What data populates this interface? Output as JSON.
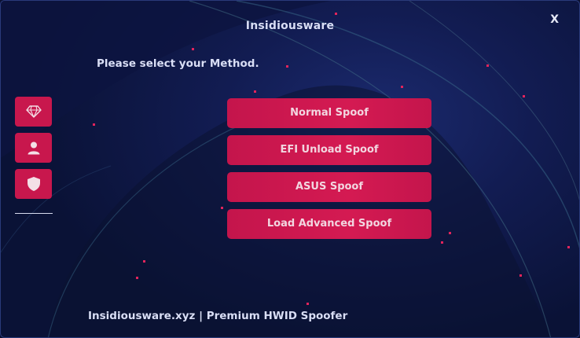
{
  "window": {
    "title": "Insidiousware",
    "close_label": "X"
  },
  "prompt": "Please select your Method.",
  "sidebar": {
    "items": [
      {
        "name": "diamond-icon"
      },
      {
        "name": "user-icon"
      },
      {
        "name": "shield-icon"
      }
    ]
  },
  "methods": [
    {
      "label": "Normal Spoof"
    },
    {
      "label": "EFI Unload Spoof"
    },
    {
      "label": "ASUS Spoof"
    },
    {
      "label": "Load Advanced Spoof"
    }
  ],
  "footer": "Insidiousware.xyz | Premium HWID Spoofer",
  "colors": {
    "accent": "#c8174d",
    "background": "#121c52",
    "text": "#d9def5"
  }
}
